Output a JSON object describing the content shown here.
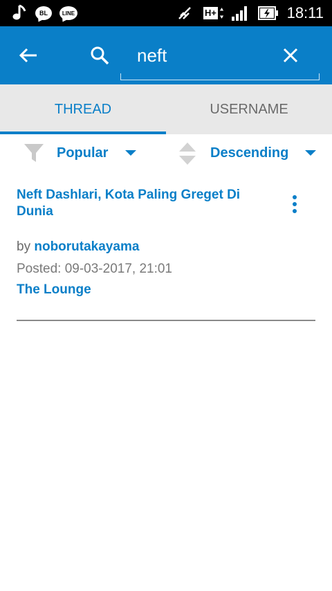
{
  "status_bar": {
    "notifications": [
      "music-note",
      "bbm",
      "line"
    ],
    "bbm_label": "BL",
    "line_label": "LINE",
    "network_label": "H+",
    "time": "18:11"
  },
  "app_bar": {
    "search_value": "neft",
    "accent": "#0a7fc8"
  },
  "tabs": [
    {
      "label": "THREAD",
      "selected": true
    },
    {
      "label": "USERNAME",
      "selected": false
    }
  ],
  "filters": {
    "sort_by": "Popular",
    "order": "Descending"
  },
  "results": [
    {
      "title": "Neft Dashlari, Kota Paling Greget Di Dunia",
      "by_prefix": "by",
      "author": "noborutakayama",
      "posted": "Posted: 09-03-2017, 21:01",
      "forum": "The Lounge"
    }
  ]
}
